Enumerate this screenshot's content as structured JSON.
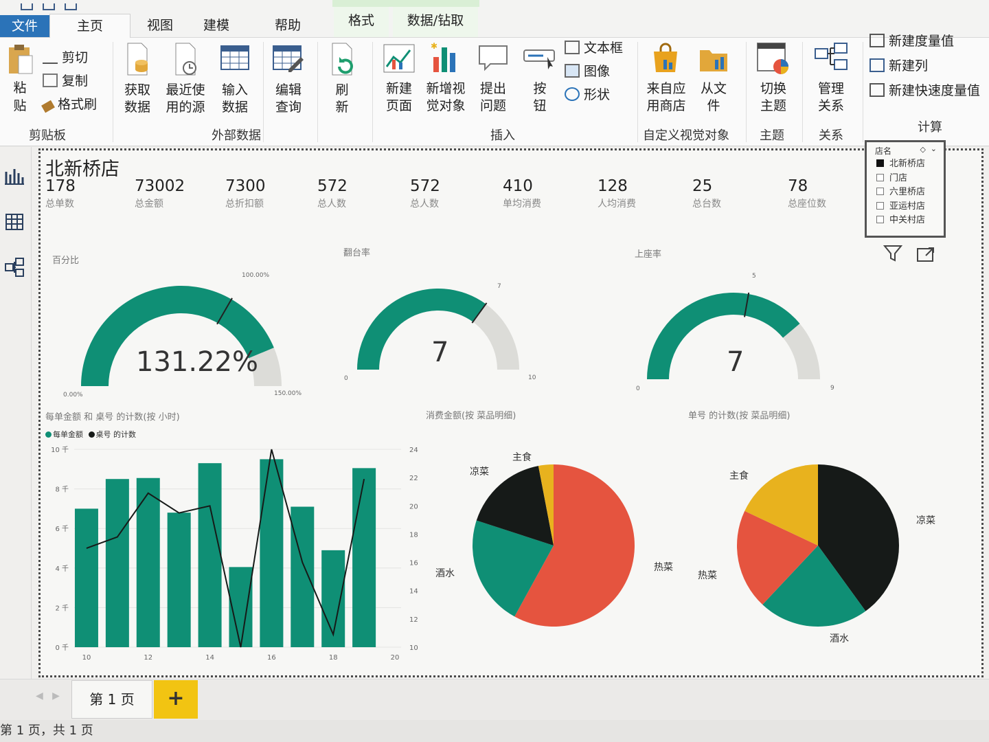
{
  "tabs": [
    "文件",
    "主页",
    "视图",
    "建模",
    "帮助",
    "格式",
    "数据/钻取"
  ],
  "ribbon": {
    "clipboard": {
      "paste": "粘贴",
      "cut": "剪切",
      "copy": "复制",
      "format_painter": "格式刷",
      "group": "剪贴板"
    },
    "external": {
      "get_data": "获取数据",
      "recent": "最近使用的源",
      "enter": "输入数据",
      "edit": "编辑查询",
      "group": "外部数据"
    },
    "refresh": "刷新",
    "insert": {
      "new_page": "新建页面",
      "new_visual": "新增视觉对象",
      "ask": "提出问题",
      "button": "按钮",
      "textbox": "文本框",
      "image": "图像",
      "shape": "形状",
      "group": "插入"
    },
    "custom": {
      "marketplace": "来自应用商店",
      "from_file": "从文件",
      "group": "自定义视觉对象"
    },
    "theme": {
      "switch": "切换主题",
      "group": "主题"
    },
    "relation": {
      "manage": "管理关系",
      "group": "关系"
    },
    "calc": {
      "new_measure": "新建度量值",
      "new_column": "新建列",
      "quick_measure": "新建快速度量值",
      "group": "计算"
    }
  },
  "report": {
    "title": "北新桥店",
    "kpis": [
      {
        "value": "178",
        "label": "总单数"
      },
      {
        "value": "73002",
        "label": "总金额"
      },
      {
        "value": "7300",
        "label": "总折扣额"
      },
      {
        "value": "572",
        "label": "总人数"
      },
      {
        "value": "572",
        "label": "总人数"
      },
      {
        "value": "410",
        "label": "单均消费"
      },
      {
        "value": "128",
        "label": "人均消费"
      },
      {
        "value": "25",
        "label": "总台数"
      },
      {
        "value": "78",
        "label": "总座位数"
      }
    ]
  },
  "gauges": [
    {
      "title": "百分比",
      "value_text": "131.22%",
      "value": 131.22,
      "min": 0,
      "max": 150,
      "target": 100,
      "min_label": "0.00%",
      "max_label": "150.00%",
      "target_label": "100.00%"
    },
    {
      "title": "翻台率",
      "value_text": "7",
      "value": 7,
      "min": 0,
      "max": 10,
      "target": 7,
      "min_label": "0",
      "max_label": "10",
      "target_label": "7"
    },
    {
      "title": "上座率",
      "value_text": "7",
      "value": 7,
      "min": 0,
      "max": 9,
      "target": 5,
      "min_label": "0",
      "max_label": "9",
      "target_label": "5"
    }
  ],
  "slicer": {
    "title": "店名",
    "items": [
      {
        "label": "北新桥店",
        "checked": true
      },
      {
        "label": "门店",
        "checked": false
      },
      {
        "label": "六里桥店",
        "checked": false
      },
      {
        "label": "亚运村店",
        "checked": false
      },
      {
        "label": "中关村店",
        "checked": false
      }
    ]
  },
  "colors": {
    "teal": "#0f8f75",
    "dark": "#161a18",
    "red": "#e5543f",
    "yellow": "#e8b21e",
    "gauge_bg": "#dcdcd8"
  },
  "chart_data": [
    {
      "type": "bar",
      "title": "每单金额 和 桌号 的计数(按 小时)",
      "x": [
        10,
        11,
        12,
        13,
        14,
        15,
        16,
        17,
        18,
        19
      ],
      "x_ticks": [
        "10",
        "12",
        "14",
        "16",
        "18",
        "20"
      ],
      "y_left_ticks": [
        "0 千",
        "2 千",
        "4 千",
        "6 千",
        "8 千",
        "10 千"
      ],
      "y_right_ticks": [
        "10",
        "12",
        "14",
        "16",
        "18",
        "20",
        "22",
        "24"
      ],
      "ylim": [
        0,
        10000
      ],
      "y2lim": [
        10,
        24
      ],
      "series": [
        {
          "name": "每单金额",
          "kind": "bar",
          "values": [
            7000,
            8500,
            8550,
            6800,
            9300,
            4050,
            9500,
            7100,
            4900,
            9050
          ]
        },
        {
          "name": "桌号 的计数",
          "kind": "line",
          "values": [
            17,
            17.8,
            20.9,
            19.5,
            20,
            10,
            24,
            16,
            10.9,
            21.9
          ]
        }
      ]
    },
    {
      "type": "pie",
      "title": "消费金额(按 菜品明细)",
      "slices": [
        {
          "label": "热菜",
          "value": 58,
          "color": "#e5543f"
        },
        {
          "label": "酒水",
          "value": 22,
          "color": "#0f8f75"
        },
        {
          "label": "凉菜",
          "value": 17,
          "color": "#161a18"
        },
        {
          "label": "主食",
          "value": 3,
          "color": "#e8b21e"
        }
      ]
    },
    {
      "type": "pie",
      "title": "单号 的计数(按 菜品明细)",
      "slices": [
        {
          "label": "凉菜",
          "value": 40,
          "color": "#161a18"
        },
        {
          "label": "酒水",
          "value": 22,
          "color": "#0f8f75"
        },
        {
          "label": "热菜",
          "value": 20,
          "color": "#e5543f"
        },
        {
          "label": "主食",
          "value": 18,
          "color": "#e8b21e"
        }
      ]
    }
  ],
  "pages": {
    "tab": "第 1 页",
    "add": "+"
  },
  "status": "第 1 页，共 1 页"
}
